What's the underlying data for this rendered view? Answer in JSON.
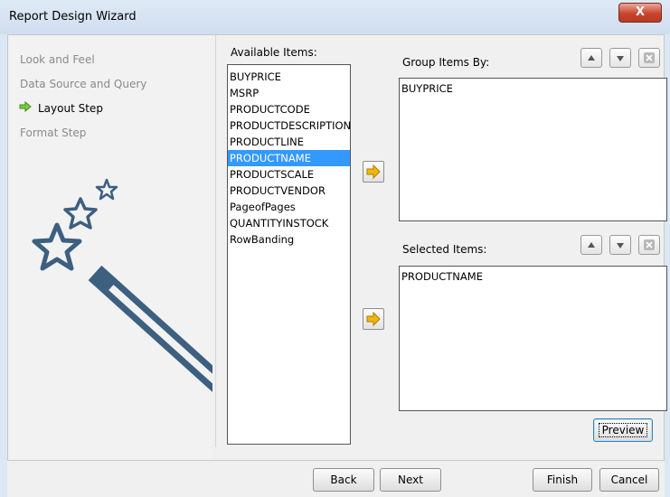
{
  "window": {
    "title": "Report Design Wizard",
    "close_label": "X"
  },
  "steps": [
    {
      "label": "Look and Feel",
      "state": "done"
    },
    {
      "label": "Data Source and Query",
      "state": "done"
    },
    {
      "label": "Layout Step",
      "state": "current"
    },
    {
      "label": "Format Step",
      "state": "pending"
    }
  ],
  "available": {
    "label": "Available Items:",
    "items": [
      "BUYPRICE",
      "MSRP",
      "PRODUCTCODE",
      "PRODUCTDESCRIPTION",
      "PRODUCTLINE",
      "PRODUCTNAME",
      "PRODUCTSCALE",
      "PRODUCTVENDOR",
      "PageofPages",
      "QUANTITYINSTOCK",
      "RowBanding"
    ],
    "selected": "PRODUCTNAME"
  },
  "group": {
    "label": "Group Items By:",
    "items": [
      "BUYPRICE"
    ]
  },
  "selected_items": {
    "label": "Selected Items:",
    "items": [
      "PRODUCTNAME"
    ]
  },
  "buttons": {
    "preview": "Preview",
    "back": "Back",
    "next": "Next",
    "finish": "Finish",
    "cancel": "Cancel"
  },
  "icons": {
    "move_right": "arrow-right-icon",
    "move_up": "triangle-up-icon",
    "move_down": "triangle-down-icon",
    "remove": "remove-icon",
    "step_current": "green-arrow-icon",
    "decoration": "wand-stars-icon"
  },
  "colors": {
    "selection": "#3399ff",
    "accent_arrow": "#f2b705",
    "wand": "#3d5f80",
    "close": "#c9452e"
  }
}
